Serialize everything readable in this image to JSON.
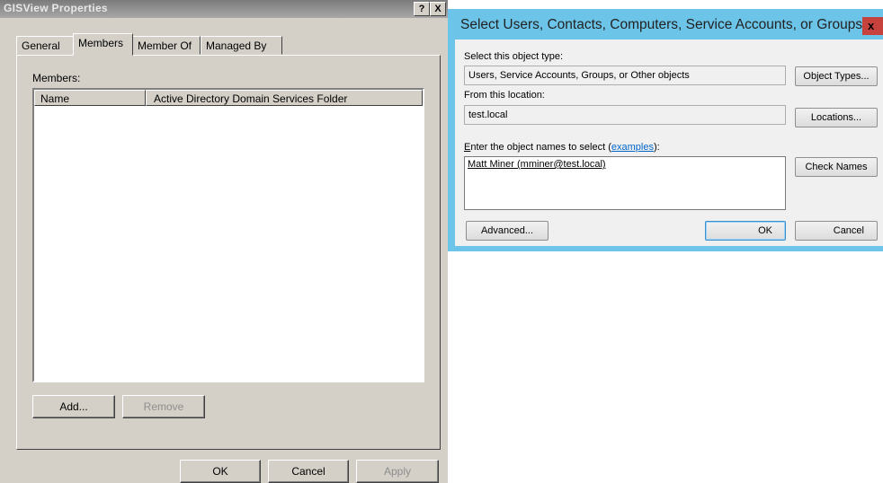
{
  "properties_dialog": {
    "title": "GISView Properties",
    "help_button": "?",
    "close_button": "X",
    "tabs": [
      "General",
      "Members",
      "Member Of",
      "Managed By"
    ],
    "active_tab": "Members",
    "members_label": "Members:",
    "columns": [
      "Name",
      "Active Directory Domain Services Folder"
    ],
    "rows": [],
    "add_button": "Add...",
    "remove_button": "Remove",
    "ok_button": "OK",
    "cancel_button": "Cancel",
    "apply_button": "Apply"
  },
  "select_dialog": {
    "title": "Select Users, Contacts, Computers, Service Accounts, or Groups",
    "close_glyph": "x",
    "object_type_label": "Select this object type:",
    "object_type_value": "Users, Service Accounts, Groups, or Other objects",
    "object_types_button": "Object Types...",
    "location_label": "From this location:",
    "location_value": "test.local",
    "locations_button": "Locations...",
    "names_label_access": "E",
    "names_label_rest": "nter the object names to select (",
    "names_label_link": "examples",
    "names_label_end": "):",
    "names_value": "Matt Miner (mminer@test.local)",
    "check_names_button": "Check Names",
    "advanced_button": "Advanced...",
    "ok_button": "OK",
    "cancel_button": "Cancel"
  }
}
